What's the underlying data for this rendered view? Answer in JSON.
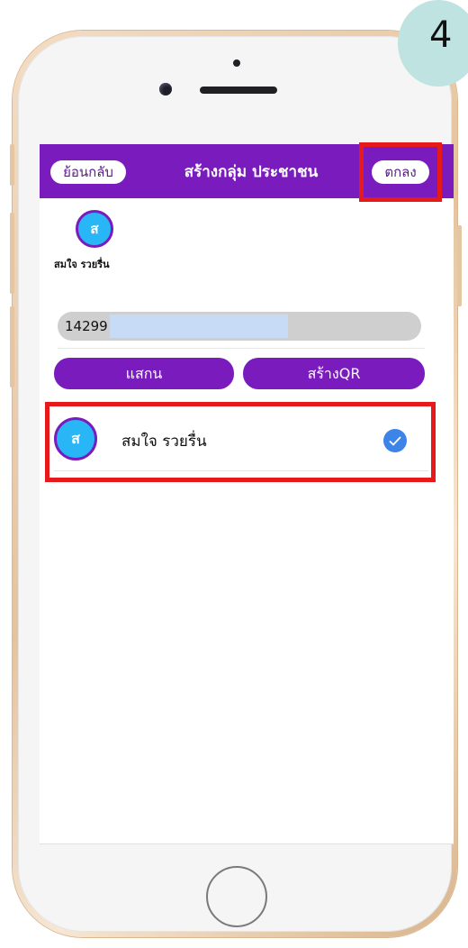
{
  "step": {
    "number": "4"
  },
  "navbar": {
    "back_label": "ย้อนกลับ",
    "title": "สร้างกลุ่ม ประชาชน",
    "ok_label": "ตกลง"
  },
  "selected_member": {
    "initial": "ส",
    "name": "สมใจ รวยรื่น"
  },
  "search": {
    "value": "14299"
  },
  "actions": {
    "scan_label": "แสกน",
    "create_qr_label": "สร้างQR"
  },
  "members": [
    {
      "initial": "ส",
      "name": "สมใจ รวยรื่น",
      "selected": true
    }
  ],
  "colors": {
    "brand": "#7a1bbd",
    "avatar": "#29b6f6",
    "check": "#3d84e8",
    "highlight": "#e61a1a"
  }
}
